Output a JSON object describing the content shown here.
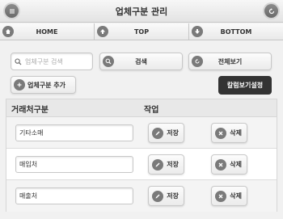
{
  "header": {
    "title": "업체구분 관리",
    "left_icon": "menu-icon",
    "right_icon": "refresh-icon"
  },
  "nav": {
    "home_label": "HOME",
    "top_label": "TOP",
    "bottom_label": "BOTTOM"
  },
  "search": {
    "placeholder": "업체구분 검색",
    "value": "",
    "search_label": "검색",
    "view_all_label": "전체보기"
  },
  "actions": {
    "add_type_label": "업체구분 추가",
    "column_settings_label": "칼럼보기설정"
  },
  "table": {
    "columns": [
      "거래처구분",
      "작업"
    ],
    "rows": [
      {
        "name": "기타소매",
        "save_label": "저장",
        "delete_label": "삭제"
      },
      {
        "name": "매입처",
        "save_label": "저장",
        "delete_label": "삭제"
      },
      {
        "name": "매출처",
        "save_label": "저장",
        "delete_label": "삭제"
      }
    ]
  },
  "colors": {
    "header_bg": "#ebebeb",
    "icon_bg": "#7a7a7a",
    "dark_button": "#333333",
    "row_alt": "#f4f4f4"
  }
}
